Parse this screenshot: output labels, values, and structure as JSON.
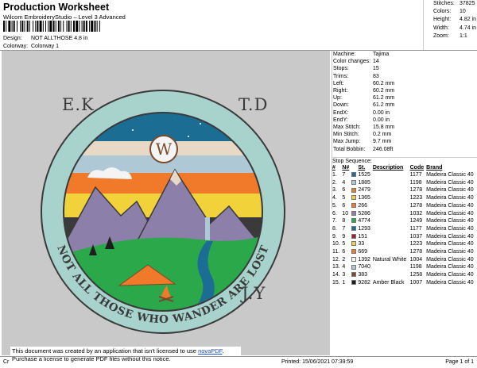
{
  "header": {
    "title": "Production Worksheet",
    "subtitle": "Wilcom EmbroideryStudio – Level 3 Advanced",
    "design_label": "Design:",
    "design_value": "NOT ALLTHOSE 4.8 in",
    "colorway_label": "Colorway:",
    "colorway_value": "Colorway 1"
  },
  "stats": {
    "stitches_label": "Stitches:",
    "stitches": "37825",
    "colors_label": "Colors:",
    "colors": "10",
    "height_label": "Height:",
    "height": "4.82 in",
    "width_label": "Width:",
    "width": "4.74 in",
    "zoom_label": "Zoom:",
    "zoom": "1:1"
  },
  "canvas": {
    "ek": "E.K",
    "td": "T.D",
    "jy": "J.Y",
    "logo_letter": "W",
    "ring_text": "NOT ALL THOSE WHO WANDER ARE LOST"
  },
  "machine_info": [
    {
      "k": "Machine:",
      "v": "Tajima"
    },
    {
      "k": "Color changes:",
      "v": "14"
    },
    {
      "k": "Stops:",
      "v": "15"
    },
    {
      "k": "Trims:",
      "v": "83"
    },
    {
      "k": "Left:",
      "v": "60.2 mm"
    },
    {
      "k": "Right:",
      "v": "60.2 mm"
    },
    {
      "k": "Up:",
      "v": "61.2 mm"
    },
    {
      "k": "Down:",
      "v": "61.2 mm"
    },
    {
      "k": "EndX:",
      "v": "0.00 in"
    },
    {
      "k": "EndY:",
      "v": "0.00 in"
    },
    {
      "k": "Max Stitch:",
      "v": "15.8 mm"
    },
    {
      "k": "Min Stitch:",
      "v": "0.2 mm"
    },
    {
      "k": "Max Jump:",
      "v": "9.7 mm"
    },
    {
      "k": "Total Bobbin:",
      "v": "246.08ft"
    }
  ],
  "stop_sequence": {
    "title": "Stop Sequence:",
    "headers": [
      "#",
      "N#",
      "St.",
      "Description",
      "Code",
      "Brand"
    ],
    "rows": [
      {
        "n": "1.",
        "nn": "7",
        "color": "#1b6d93",
        "st": "1525",
        "desc": "",
        "code": "1177",
        "brand": "Madeira Classic 40"
      },
      {
        "n": "2.",
        "nn": "4",
        "color": "#aec8d6",
        "st": "1885",
        "desc": "",
        "code": "1198",
        "brand": "Madeira Classic 40"
      },
      {
        "n": "3.",
        "nn": "6",
        "color": "#f07a2a",
        "st": "2479",
        "desc": "",
        "code": "1278",
        "brand": "Madeira Classic 40"
      },
      {
        "n": "4.",
        "nn": "5",
        "color": "#f2d23a",
        "st": "1365",
        "desc": "",
        "code": "1223",
        "brand": "Madeira Classic 40"
      },
      {
        "n": "5.",
        "nn": "6",
        "color": "#f07a2a",
        "st": "266",
        "desc": "",
        "code": "1278",
        "brand": "Madeira Classic 40"
      },
      {
        "n": "6.",
        "nn": "10",
        "color": "#8c7faa",
        "st": "5286",
        "desc": "",
        "code": "1032",
        "brand": "Madeira Classic 40"
      },
      {
        "n": "7.",
        "nn": "8",
        "color": "#2aa84a",
        "st": "4774",
        "desc": "",
        "code": "1249",
        "brand": "Madeira Classic 40"
      },
      {
        "n": "8.",
        "nn": "7",
        "color": "#1b6d93",
        "st": "1293",
        "desc": "",
        "code": "1177",
        "brand": "Madeira Classic 40"
      },
      {
        "n": "9.",
        "nn": "9",
        "color": "#a31d3d",
        "st": "151",
        "desc": "",
        "code": "1037",
        "brand": "Madeira Classic 40"
      },
      {
        "n": "10.",
        "nn": "5",
        "color": "#f2d23a",
        "st": "33",
        "desc": "",
        "code": "1223",
        "brand": "Madeira Classic 40"
      },
      {
        "n": "11.",
        "nn": "6",
        "color": "#f07a2a",
        "st": "669",
        "desc": "",
        "code": "1278",
        "brand": "Madeira Classic 40"
      },
      {
        "n": "12.",
        "nn": "2",
        "color": "#f4f4f4",
        "st": "1392",
        "desc": "Natural White",
        "code": "1004",
        "brand": "Madeira Classic 40"
      },
      {
        "n": "13.",
        "nn": "4",
        "color": "#aec8d6",
        "st": "7040",
        "desc": "",
        "code": "1198",
        "brand": "Madeira Classic 40"
      },
      {
        "n": "14.",
        "nn": "3",
        "color": "#7a4a2a",
        "st": "383",
        "desc": "",
        "code": "1258",
        "brand": "Madeira Classic 40"
      },
      {
        "n": "15.",
        "nn": "1",
        "color": "#1e1e1e",
        "st": "9282",
        "desc": "Amber Black",
        "code": "1007",
        "brand": "Madeira Classic 40"
      }
    ]
  },
  "watermark": {
    "line1_prefix": "This document was created by an application that isn't licensed to use ",
    "link": "novaPDF",
    "line1_suffix": ".",
    "line2": "Purchase a license to generate PDF files without this notice."
  },
  "footer": {
    "left": "Cr",
    "printed": "Printed: 15/06/2021 07:39:59",
    "page": "Page 1 of 1"
  }
}
